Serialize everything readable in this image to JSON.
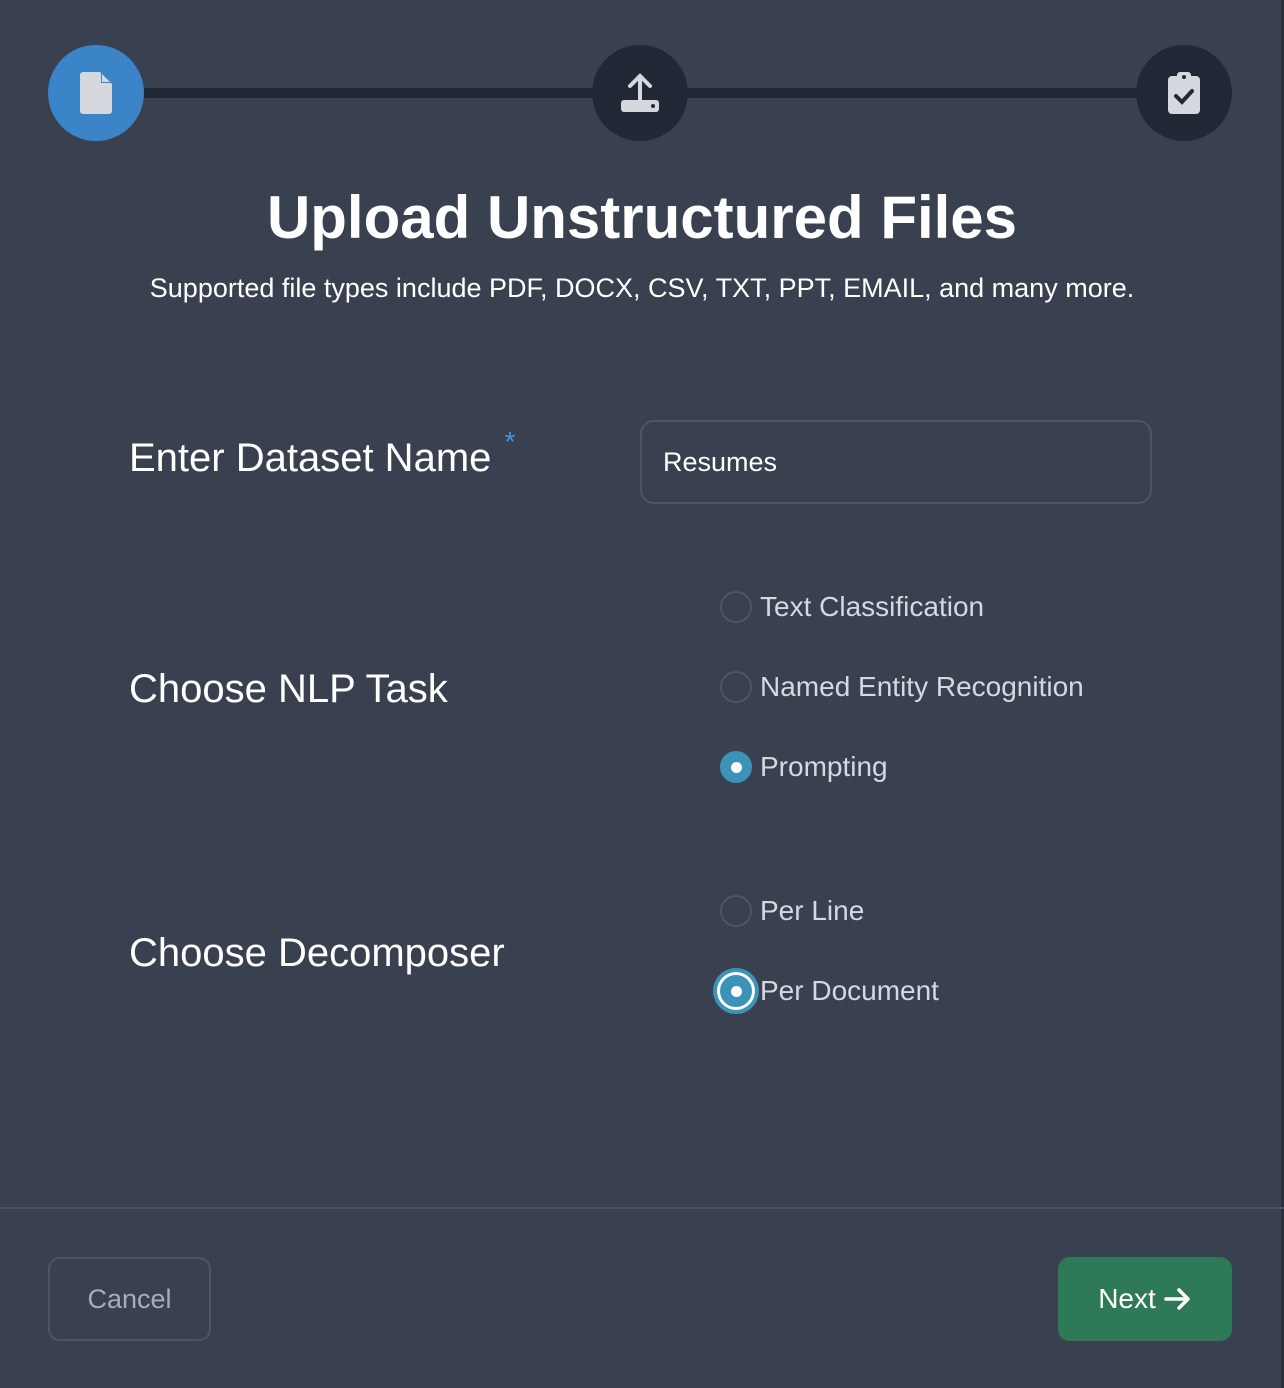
{
  "stepper": {
    "steps": [
      {
        "icon": "file-icon",
        "active": true
      },
      {
        "icon": "upload-icon",
        "active": false
      },
      {
        "icon": "clipboard-check-icon",
        "active": false
      }
    ],
    "accent": "#3a84c7"
  },
  "title": "Upload Unstructured Files",
  "subtitle": "Supported file types include PDF, DOCX, CSV, TXT, PPT, EMAIL, and many more.",
  "dataset": {
    "label": "Enter Dataset Name",
    "required": "*",
    "value": "Resumes"
  },
  "nlp_task": {
    "label": "Choose NLP Task",
    "options": [
      "Text Classification",
      "Named Entity Recognition",
      "Prompting"
    ],
    "selected": "Prompting"
  },
  "decomposer": {
    "label": "Choose Decomposer",
    "options": [
      "Per Line",
      "Per Document"
    ],
    "selected": "Per Document"
  },
  "footer": {
    "cancel": "Cancel",
    "next": "Next"
  }
}
